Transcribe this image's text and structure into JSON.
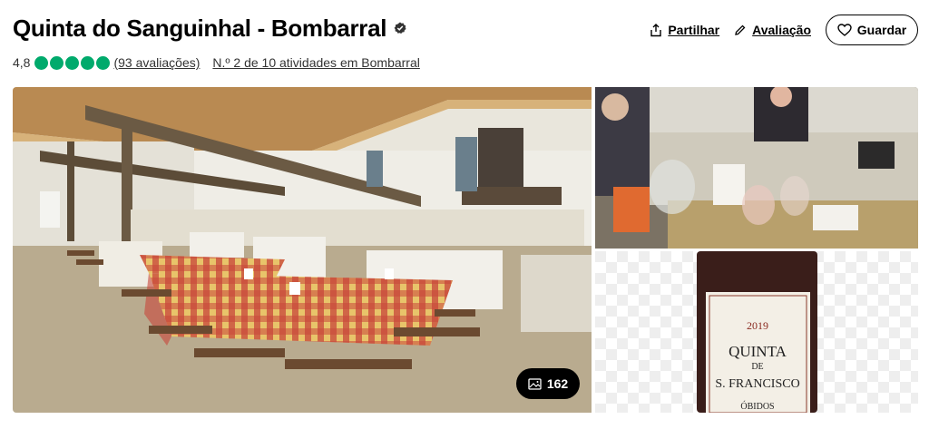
{
  "header": {
    "title": "Quinta do Sanguinhal - Bombarral",
    "rating_value": "4,8",
    "rating_bubbles": 5,
    "reviews_text": "(93 avaliações)",
    "rank_text": "N.º 2 de 10 atividades em Bombarral"
  },
  "actions": {
    "share_label": "Partilhar",
    "review_label": "Avaliação",
    "save_label": "Guardar"
  },
  "gallery": {
    "photo_count": "162"
  },
  "bottle": {
    "year": "2019",
    "line1": "QUINTA",
    "line2": "DE",
    "line3": "S. FRANCISCO",
    "region": "ÓBIDOS"
  },
  "colors": {
    "rating_green": "#00aa6c",
    "accent_black": "#000000"
  }
}
